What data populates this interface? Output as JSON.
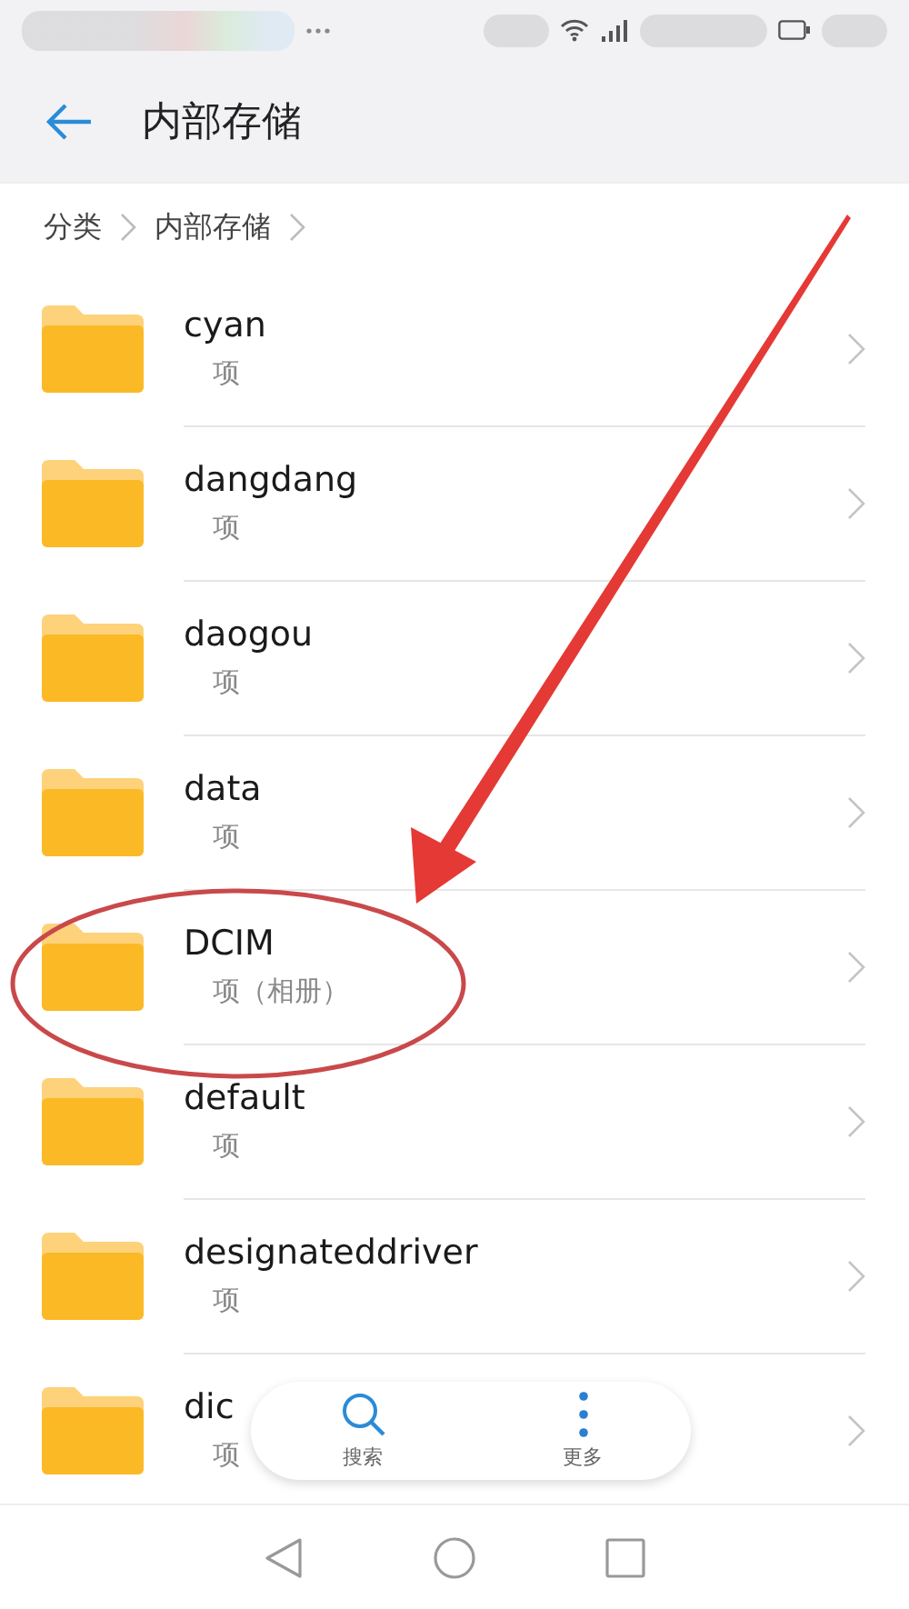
{
  "header": {
    "title": "内部存储"
  },
  "breadcrumb": [
    {
      "label": "分类"
    },
    {
      "label": "内部存储"
    }
  ],
  "folders": [
    {
      "name": "cyan",
      "info": "项"
    },
    {
      "name": "dangdang",
      "info": "项"
    },
    {
      "name": "daogou",
      "info": "项"
    },
    {
      "name": "data",
      "info": "项"
    },
    {
      "name": "DCIM",
      "info": "项（相册）"
    },
    {
      "name": "default",
      "info": "项"
    },
    {
      "name": "designateddriver",
      "info": "项"
    },
    {
      "name": "dic",
      "info": "项"
    }
  ],
  "toolbar": [
    {
      "kind": "search",
      "label": "搜索"
    },
    {
      "kind": "more",
      "label": "更多"
    }
  ]
}
